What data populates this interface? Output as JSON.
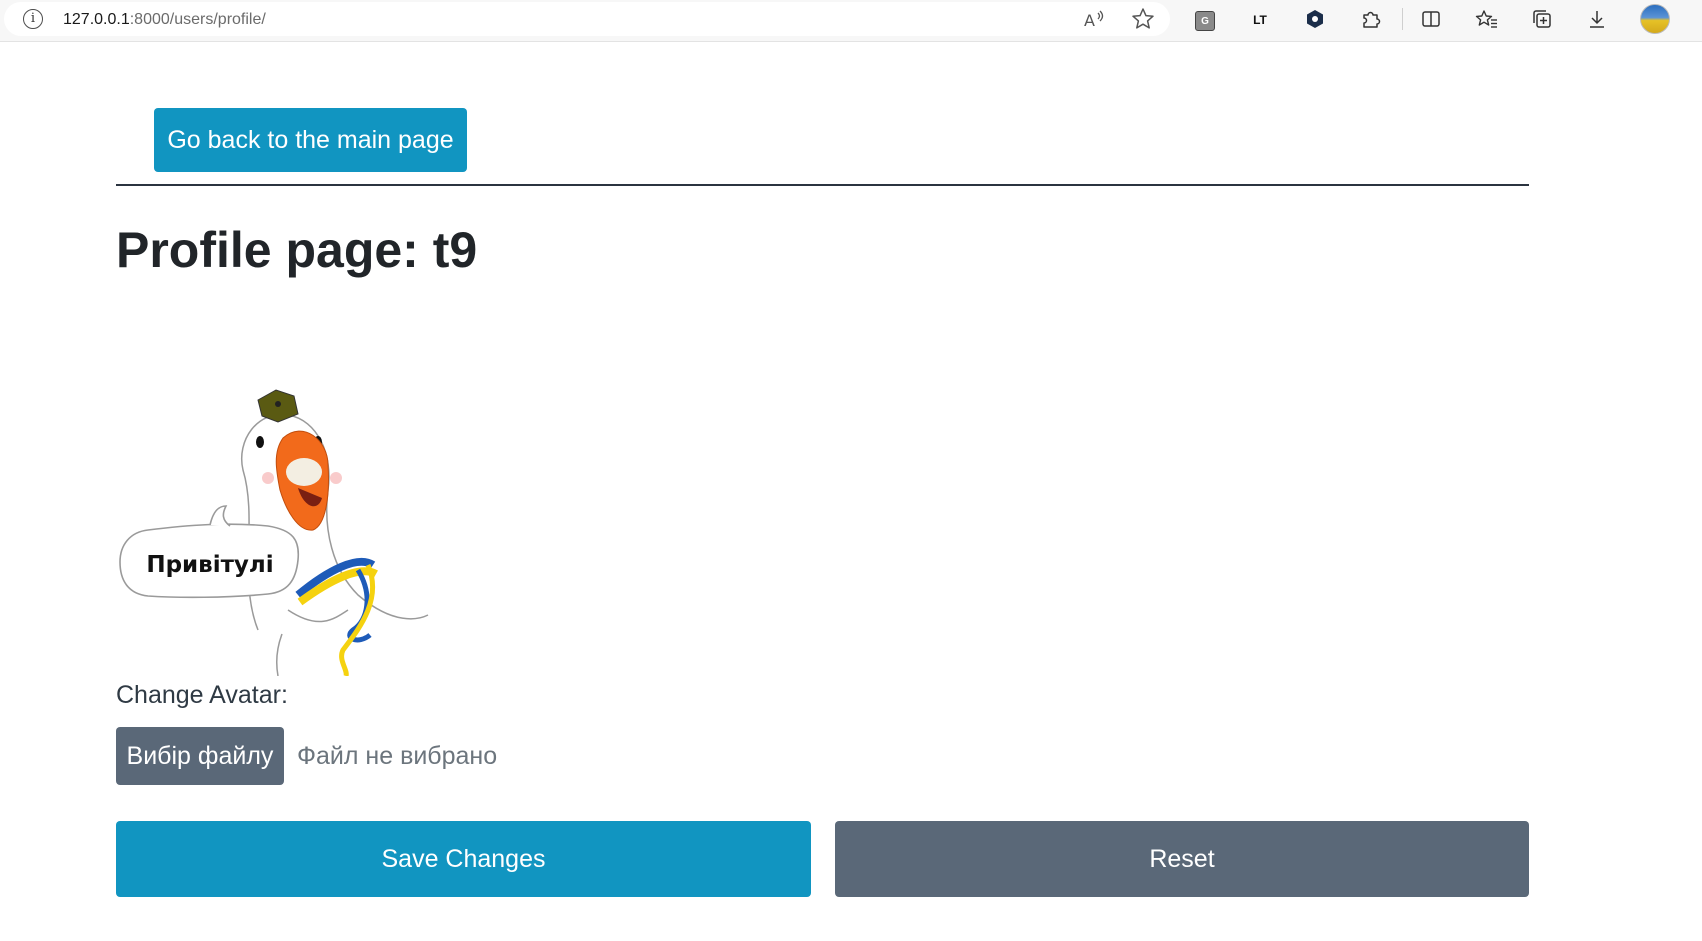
{
  "browser": {
    "url_host": "127.0.0.1",
    "url_path": ":8000/users/profile/",
    "address_icons": [
      "read-aloud-icon",
      "favorite-star-icon"
    ],
    "toolbar_icons": [
      "extension-icon-1",
      "extension-icon-lt",
      "extension-icon-hex",
      "extensions-puzzle-icon",
      "split-screen-icon",
      "favorites-icon",
      "collections-icon",
      "downloads-icon",
      "profile-avatar"
    ],
    "extension_labels": {
      "lt": "LT"
    }
  },
  "page": {
    "back_button": "Go back to the main page",
    "title": "Profile page: t9",
    "avatar": {
      "speech_text": "Привітулі",
      "colors": {
        "ribbon_blue": "#1e5bb8",
        "ribbon_yellow": "#f5d20f",
        "beak": "#f26a1b",
        "hat": "#5a5a12"
      }
    },
    "change_avatar_label": "Change Avatar:",
    "file_button": "Вибір файлу",
    "file_status": "Файл не вибрано",
    "save_button": "Save Changes",
    "reset_button": "Reset"
  },
  "colors": {
    "primary": "#1195c1",
    "secondary": "#5a6878",
    "text": "#212529"
  }
}
